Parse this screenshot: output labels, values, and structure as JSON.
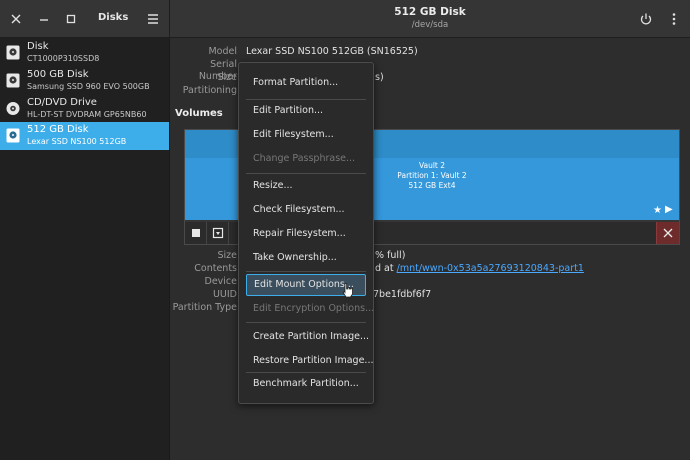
{
  "header": {
    "sidebar_title": "Disks",
    "title": "512 GB Disk",
    "subtitle": "/dev/sda"
  },
  "sidebar": {
    "drives": [
      {
        "name": "Disk",
        "model": "CT1000P310SSD8",
        "icon": "disk-icon"
      },
      {
        "name": "500 GB Disk",
        "model": "Samsung SSD 960 EVO 500GB",
        "icon": "disk-icon"
      },
      {
        "name": "CD/DVD Drive",
        "model": "HL-DT-ST DVDRAM GP65NB60",
        "icon": "optical-drive-icon"
      },
      {
        "name": "512 GB Disk",
        "model": "Lexar SSD NS100 512GB",
        "icon": "disk-icon",
        "selected": true
      }
    ]
  },
  "disk_info": {
    "model_label": "Model",
    "model_value": "Lexar SSD NS100 512GB (SN16525)",
    "serial_label": "Serial Number",
    "size_label": "Size",
    "size_value_fragment": "s)",
    "partitioning_label": "Partitioning"
  },
  "volumes": {
    "title": "Volumes",
    "partition_lines": [
      "Vault 2",
      "Partition 1: Vault 2",
      "512 GB Ext4"
    ]
  },
  "volume_info": {
    "size_label": "Size",
    "size_value_fragment": "% full)",
    "contents_label": "Contents",
    "contents_prefix": "d at ",
    "contents_link": "/mnt/wwn-0x53a5a27693120843-part1",
    "device_label": "Device",
    "uuid_label": "UUID",
    "uuid_value_fragment": "7be1fdbf6f7",
    "partition_type_label": "Partition Type"
  },
  "context_menu": {
    "items": [
      {
        "label": "Format Partition...",
        "enabled": true
      },
      {
        "label": "Edit Partition...",
        "enabled": true
      },
      {
        "label": "Edit Filesystem...",
        "enabled": true
      },
      {
        "label": "Change Passphrase...",
        "enabled": false
      },
      {
        "label": "Resize...",
        "enabled": true
      },
      {
        "label": "Check Filesystem...",
        "enabled": true
      },
      {
        "label": "Repair Filesystem...",
        "enabled": true
      },
      {
        "label": "Take Ownership...",
        "enabled": true
      },
      {
        "label": "Edit Mount Options...",
        "enabled": true,
        "hovered": true
      },
      {
        "label": "Edit Encryption Options...",
        "enabled": false
      },
      {
        "label": "Create Partition Image...",
        "enabled": true
      },
      {
        "label": "Restore Partition Image...",
        "enabled": true
      },
      {
        "label": "Benchmark Partition...",
        "enabled": true
      }
    ]
  },
  "colors": {
    "accent": "#3daee9",
    "partition": "#3498db",
    "link": "#4aa8ff"
  }
}
